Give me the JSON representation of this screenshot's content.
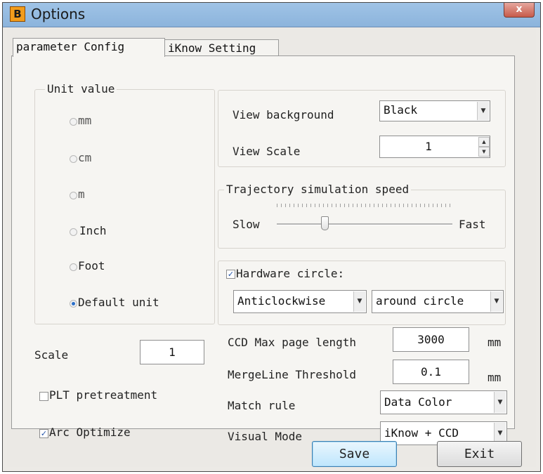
{
  "window": {
    "title": "Options",
    "icon_letter": "B",
    "close_glyph": "x"
  },
  "tabs": [
    {
      "label": "parameter Config",
      "active": true
    },
    {
      "label": "iKnow Setting",
      "active": false
    }
  ],
  "unit_group": {
    "title": "Unit value",
    "options": [
      {
        "label": "mm",
        "checked": false
      },
      {
        "label": "cm",
        "checked": false
      },
      {
        "label": "m",
        "checked": false
      },
      {
        "label": "Inch",
        "checked": false
      },
      {
        "label": "Foot",
        "checked": false
      },
      {
        "label": "Default unit",
        "checked": true
      }
    ]
  },
  "view": {
    "background_label": "View background",
    "background_value": "Black",
    "scale_label": "View Scale",
    "scale_value": "1"
  },
  "trajectory": {
    "title": "Trajectory simulation speed",
    "slow_label": "Slow",
    "fast_label": "Fast",
    "speed_fraction": 0.27
  },
  "hardware_circle": {
    "label": "Hardware circle:",
    "checked": true,
    "direction_value": "Anticlockwise",
    "mode_value": "around circle"
  },
  "left": {
    "scale_label": "Scale",
    "scale_value": "1",
    "plt_label": "PLT pretreatment",
    "plt_checked": false,
    "arc_label": "Arc Optimize",
    "arc_checked": true
  },
  "ccd": {
    "max_page_label": "CCD Max page length",
    "max_page_value": "3000",
    "max_page_unit": "mm",
    "merge_label": "MergeLine Threshold",
    "merge_value": "0.1",
    "merge_unit": "mm",
    "match_label": "Match rule",
    "match_value": "Data Color",
    "visual_label": "Visual Mode",
    "visual_value": "iKnow + CCD"
  },
  "buttons": {
    "save": "Save",
    "exit": "Exit"
  },
  "colors": {
    "titlebar": "#9fc3e6",
    "close": "#c75b4b",
    "radio_checked": "#2a6fc9",
    "dialog_bg": "#ebe9e5"
  }
}
